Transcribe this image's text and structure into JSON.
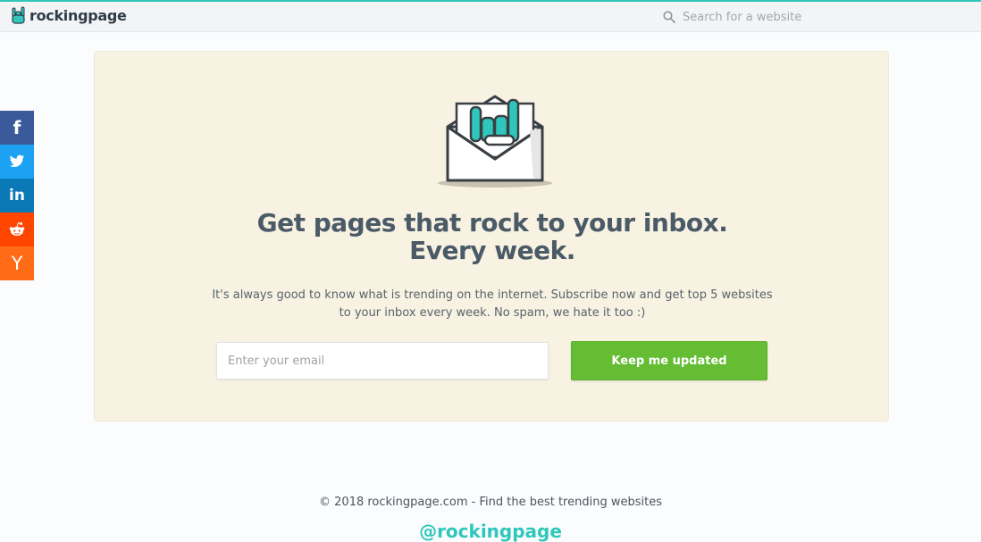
{
  "header": {
    "logo_text": "rockingpage",
    "logo_icon": "rock-hand-icon",
    "search": {
      "placeholder": "Search for a website",
      "value": "",
      "icon": "search-icon"
    },
    "accent_color": "#2fc7bb"
  },
  "social": {
    "buttons": [
      {
        "label": "f",
        "icon": "facebook-icon",
        "color": "#3b5a9b"
      },
      {
        "label": "",
        "icon": "twitter-icon",
        "color": "#1da1f2"
      },
      {
        "label": "in",
        "icon": "linkedin-icon",
        "color": "#0a79b6"
      },
      {
        "label": "",
        "icon": "reddit-icon",
        "color": "#ff4500"
      },
      {
        "label": "Y",
        "icon": "ycombinator-icon",
        "color": "#ff6b17"
      }
    ]
  },
  "newsletter": {
    "illustration": "envelope-rock-hand-icon",
    "headline_line1": "Get pages that rock to your inbox.",
    "headline_line2": "Every week.",
    "description": "It's always good to know what is trending on the internet. Subscribe now and get top 5 websites to your inbox every week. No spam, we hate it too :)",
    "email_placeholder": "Enter your email",
    "email_value": "",
    "button_label": "Keep me updated",
    "button_color": "#64bd32",
    "background_color": "#f7f2e2"
  },
  "footer": {
    "copyright": "© 2018 rockingpage.com - Find the best trending websites",
    "handle": "@rockingpage"
  }
}
